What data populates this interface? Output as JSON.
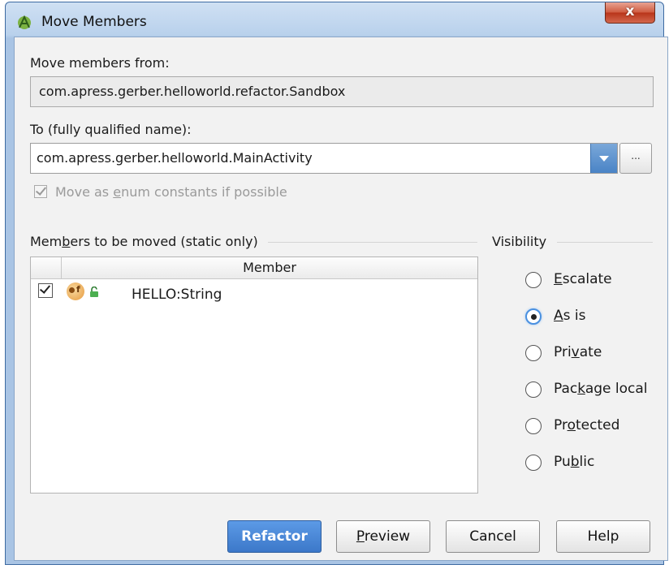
{
  "window": {
    "title": "Move Members",
    "close_label": "x"
  },
  "from": {
    "label": "Move members from:",
    "value": "com.apress.gerber.helloworld.refactor.Sandbox"
  },
  "to": {
    "label": "To (fully qualified name):",
    "value": "com.apress.gerber.helloworld.MainActivity",
    "browse_label": "..."
  },
  "enum_option": {
    "label_before": "Move as ",
    "label_mnemonic": "e",
    "label_after": "num constants if possible",
    "checked": true,
    "disabled": true
  },
  "members": {
    "label_before": "Mem",
    "label_mnemonic": "b",
    "label_after": "ers to be moved (static only)",
    "column_header": "Member",
    "rows": [
      {
        "checked": true,
        "name": "HELLO:String"
      }
    ]
  },
  "visibility": {
    "label": "Visibility",
    "selected": "As is",
    "options": [
      {
        "pre": "",
        "mn": "E",
        "post": "scalate"
      },
      {
        "pre": "",
        "mn": "A",
        "post": "s is"
      },
      {
        "pre": "Pri",
        "mn": "v",
        "post": "ate"
      },
      {
        "pre": "Pac",
        "mn": "k",
        "post": "age local"
      },
      {
        "pre": "Pr",
        "mn": "o",
        "post": "tected"
      },
      {
        "pre": "Pu",
        "mn": "b",
        "post": "lic"
      }
    ]
  },
  "buttons": {
    "refactor": "Refactor",
    "preview_mn": "P",
    "preview_rest": "review",
    "cancel": "Cancel",
    "help": "Help"
  },
  "colors": {
    "primary_button": "#3c78c9",
    "focus_ring": "#4a90e0",
    "title_bar": "#b9d1ec"
  }
}
